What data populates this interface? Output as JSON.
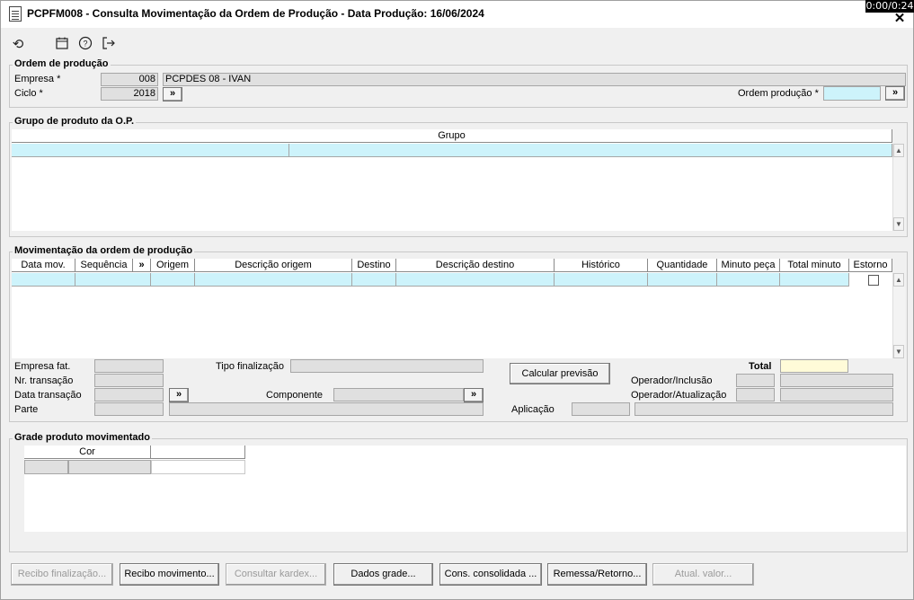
{
  "window": {
    "title": "PCPFM008 - Consulta Movimentação da Ordem de Produção - Data Produção: 16/06/2024",
    "timer": "0:00/0:24",
    "close": "✕"
  },
  "toolbar": {
    "icons": [
      "refresh-icon",
      "calendar-icon",
      "help-icon",
      "exit-icon"
    ]
  },
  "ordem": {
    "title": "Ordem de produção",
    "empresa_label": "Empresa *",
    "empresa_code": "008",
    "empresa_name": "PCPDES 08 - IVAN",
    "ciclo_label": "Ciclo *",
    "ciclo_value": "2018",
    "ciclo_btn": "»",
    "ordem_label": "Ordem produção *",
    "ordem_value": "",
    "ordem_btn": "»"
  },
  "grupo": {
    "title": "Grupo de produto da O.P.",
    "col": "Grupo"
  },
  "mov": {
    "title": "Movimentação da ordem de produção",
    "columns": [
      "Data mov.",
      "Sequência",
      "»",
      "Origem",
      "Descrição origem",
      "Destino",
      "Descrição destino",
      "Histórico",
      "Quantidade",
      "Minuto peça",
      "Total minuto",
      "Estorno"
    ],
    "empresa_fat_label": "Empresa fat.",
    "nr_transacao_label": "Nr. transação",
    "data_transacao_label": "Data transação",
    "parte_label": "Parte",
    "tipo_finalizacao_label": "Tipo finalização",
    "componente_label": "Componente",
    "comp_btn1": "»",
    "comp_btn2": "»",
    "calcular_label": "Calcular previsão",
    "total_label": "Total",
    "operador_inclusao_label": "Operador/Inclusão",
    "operador_atualizacao_label": "Operador/Atualização",
    "aplicacao_label": "Aplicação"
  },
  "grade": {
    "title": "Grade produto movimentado",
    "col": "Cor"
  },
  "buttons": [
    {
      "label": "Recibo finalização...",
      "enabled": false
    },
    {
      "label": "Recibo movimento...",
      "enabled": true
    },
    {
      "label": "Consultar kardex...",
      "enabled": false
    },
    {
      "label": "Dados grade...",
      "enabled": true
    },
    {
      "label": "Cons. consolidada ...",
      "enabled": true
    },
    {
      "label": "Remessa/Retorno...",
      "enabled": true
    },
    {
      "label": "Atual. valor...",
      "enabled": false
    }
  ]
}
